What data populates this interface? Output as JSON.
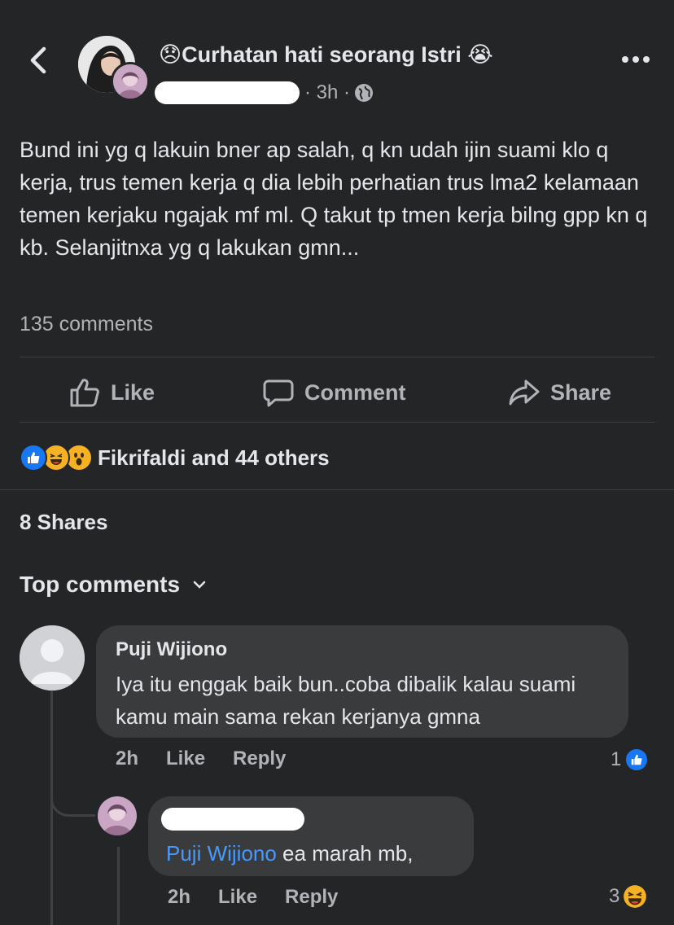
{
  "header": {
    "group_name": "😞Curhatan hati seorang Istri 😭",
    "time": "· 3h ·",
    "back_icon": "chevron-left-icon",
    "more_icon": "ellipsis-icon",
    "privacy_icon": "globe-icon"
  },
  "post": {
    "text": "Bund ini yg q lakuin bner ap salah, q kn udah ijin suami klo q kerja, trus temen kerja q dia lebih perhatian trus lma2 kelamaan temen kerjaku ngajak mf ml. Q takut tp tmen kerja bilng gpp kn q kb. Selanjitnxa yg q lakukan gmn...",
    "comments_count": "135 comments"
  },
  "actions": {
    "like": "Like",
    "comment": "Comment",
    "share": "Share"
  },
  "reactions": {
    "summary": "Fikrifaldi and 44 others",
    "icons": [
      "like-reaction-icon",
      "haha-reaction-icon",
      "wow-reaction-icon"
    ]
  },
  "shares": "8 Shares",
  "top_comments": {
    "label": "Top comments"
  },
  "comments": [
    {
      "author": "Puji Wijiono",
      "text": "Iya itu enggak baik bun..coba dibalik kalau suami kamu main sama rekan kerjanya gmna",
      "time": "2h",
      "like": "Like",
      "reply": "Reply",
      "reaction_count": "1"
    }
  ],
  "reply": {
    "mention": "Puji Wijiono",
    "text": " ea marah mb,",
    "time": "2h",
    "like": "Like",
    "reply": "Reply",
    "reaction_count": "3"
  },
  "colors": {
    "background": "#242526",
    "bubble": "#3a3b3c",
    "text": "#e4e6eb",
    "muted": "#b0b3b8",
    "mention": "#4599ff",
    "like_blue": "#1877f2"
  }
}
